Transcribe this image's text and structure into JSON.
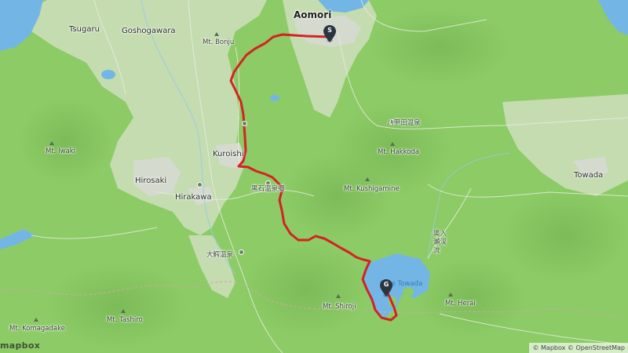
{
  "map": {
    "colors": {
      "forest": "#8ccb66",
      "lowland": "#c4dcb0",
      "urban": "#d5dacf",
      "water": "#73b6e6",
      "route": "#d42323",
      "marker": "#2a3540"
    },
    "markers": {
      "start": {
        "label": "S"
      },
      "goal": {
        "label": "G"
      }
    },
    "places": {
      "aomori": "Aomori",
      "tsugaru": "Tsugaru",
      "goshogawara": "Goshogawara",
      "mt_bonju": "Mt. Bonju",
      "mt_iwaki": "Mt. Iwaki",
      "kuroishi": "Kuroishi",
      "hirosaki": "Hirosaki",
      "hirakawa": "Hirakawa",
      "hakkoda_onsen": "八甲田温泉",
      "mt_hakkoda": "Mt. Hakkoda",
      "kuroishi_onsen": "黒石温泉郷",
      "mt_kushigamine": "Mt. Kushigamine",
      "towada": "Towada",
      "oirase_keiryu": "奥入瀬渓流",
      "owani_onsen": "大鰐温泉",
      "lake_towada": "Lake Towada",
      "mt_shiroji": "Mt. Shiroji",
      "mt_herai": "Mt. Herai",
      "mt_komagadake": "Mt. Komagadake",
      "mt_tashiro": "Mt. Tashiro"
    },
    "logo": "mapbox",
    "attribution": "© Mapbox © OpenStreetMap"
  }
}
